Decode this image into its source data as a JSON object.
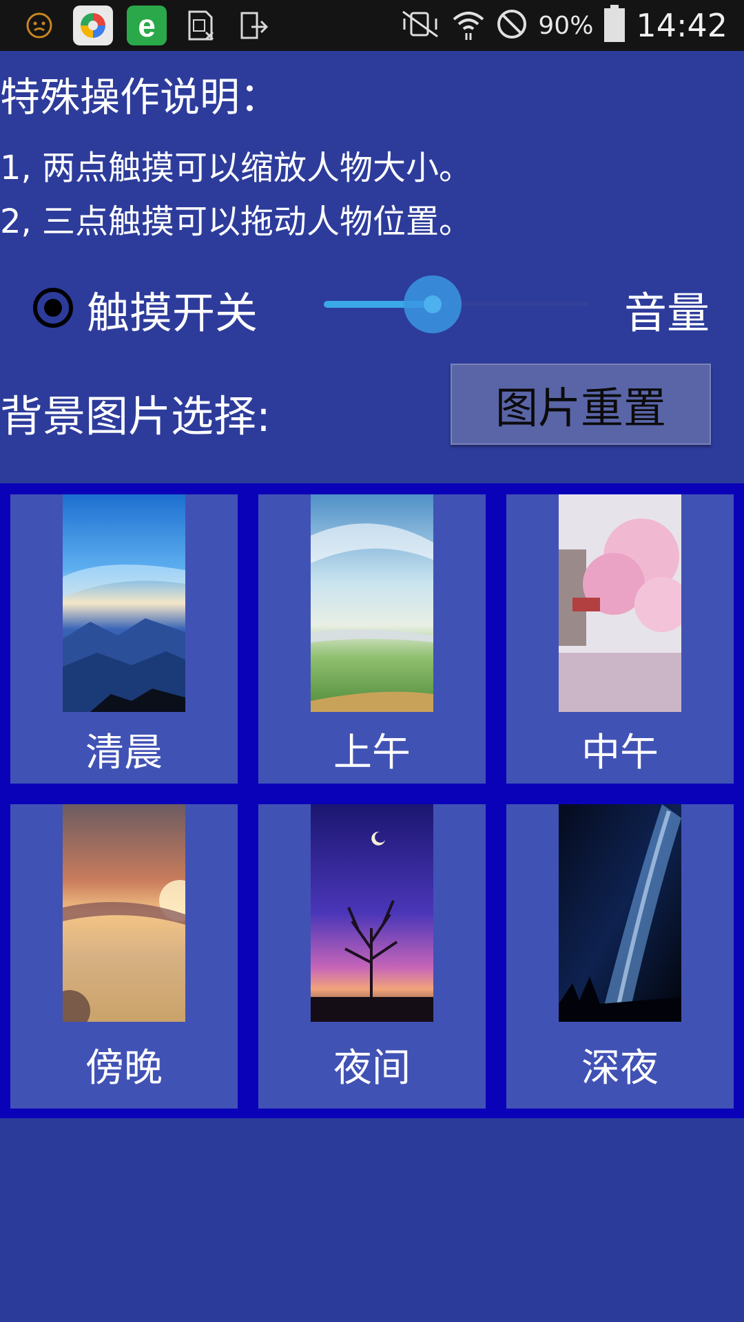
{
  "status_bar": {
    "battery_percent": "90%",
    "time": "14:42",
    "icons": [
      "face-icon",
      "app-store-icon",
      "browser-e-icon",
      "sim-card-icon",
      "file-export-icon",
      "vibrate-mute-icon",
      "wifi-icon",
      "do-not-disturb-icon",
      "battery-icon"
    ]
  },
  "instructions": {
    "title": "特殊操作说明：",
    "line1": "1, 两点触摸可以缩放人物大小。",
    "line2": "2, 三点触摸可以拖动人物位置。"
  },
  "controls": {
    "touch_switch_label": "触摸开关",
    "touch_switch_checked": true,
    "volume_label": "音量",
    "volume_level": 0.41
  },
  "background": {
    "label": "背景图片选择:",
    "reset_button_label": "图片重置"
  },
  "tiles": [
    {
      "label": "清晨",
      "image": "morning-mountains-image"
    },
    {
      "label": "上午",
      "image": "forenoon-meadow-image"
    },
    {
      "label": "中午",
      "image": "noon-cherry-blossom-image"
    },
    {
      "label": "傍晚",
      "image": "evening-sunset-image"
    },
    {
      "label": "夜间",
      "image": "night-tree-moon-image"
    },
    {
      "label": "深夜",
      "image": "late-night-milky-way-image"
    }
  ]
}
